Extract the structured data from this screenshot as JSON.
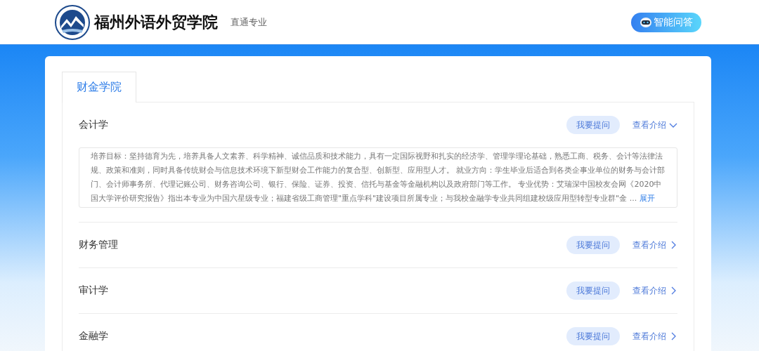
{
  "header": {
    "school_name": "福州外语外贸学院",
    "subtitle": "直通专业",
    "ask_button": "智能问答"
  },
  "tabs": [
    {
      "label": "财金学院",
      "selected": true
    }
  ],
  "majors": [
    {
      "name": "会计学",
      "ask": "我要提问",
      "intro": "查看介绍",
      "expanded": true,
      "description": "培养目标：坚持德育为先，培养具备人文素养、科学精神、诚信品质和技术能力，具有一定国际视野和扎实的经济学、管理学理论基础，熟悉工商、税务、会计等法律法规、政策和准则，同时具备传统财会与信息技术环境下新型财会工作能力的复合型、创新型、应用型人才。 就业方向：学生毕业后适合到各类企事业单位的财务与会计部门、会计师事务所、代理记账公司、财务咨询公司、银行、保险、证券、投资、信托与基金等金融机构以及政府部门等工作。 专业优势：艾瑞深中国校友会网《2020中国大学评价研究报告》指出本专业为中国六星级专业；福建省级工商管理\"重点学科\"建设项目所属专业；与我校金融学专业共同组建校级应用型转型专业群\"金 ...",
      "expand_link": "展开"
    },
    {
      "name": "财务管理",
      "ask": "我要提问",
      "intro": "查看介绍",
      "expanded": false
    },
    {
      "name": "审计学",
      "ask": "我要提问",
      "intro": "查看介绍",
      "expanded": false
    },
    {
      "name": "金融学",
      "ask": "我要提问",
      "intro": "查看介绍",
      "expanded": false
    }
  ]
}
